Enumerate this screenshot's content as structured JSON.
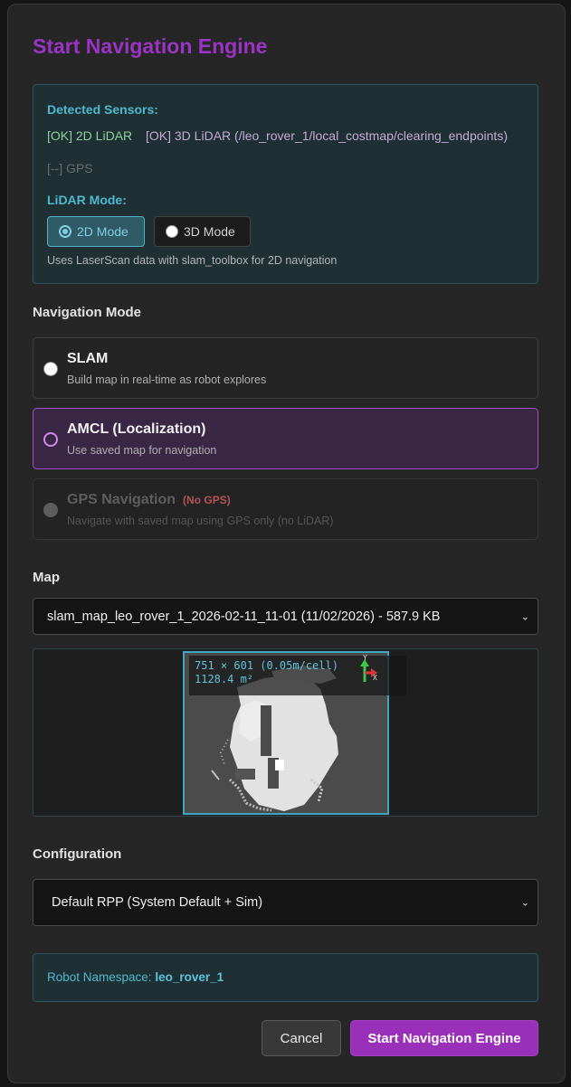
{
  "dialog": {
    "title": "Start Navigation Engine"
  },
  "sensors": {
    "heading": "Detected Sensors:",
    "lidar_2d": "[OK] 2D LiDAR",
    "lidar_3d": "[OK] 3D LiDAR (/leo_rover_1/local_costmap/clearing_endpoints)",
    "gps": "[--] GPS",
    "lidar_mode_heading": "LiDAR Mode:",
    "modes": [
      {
        "label": "2D Mode",
        "selected": true
      },
      {
        "label": "3D Mode",
        "selected": false
      }
    ],
    "mode_description": "Uses LaserScan data with slam_toolbox for 2D navigation"
  },
  "navigation": {
    "heading": "Navigation Mode",
    "options": [
      {
        "title": "SLAM",
        "description": "Build map in real-time as robot explores",
        "state": "normal"
      },
      {
        "title": "AMCL (Localization)",
        "description": "Use saved map for navigation",
        "state": "selected"
      },
      {
        "title": "GPS Navigation",
        "badge": "(No GPS)",
        "description": "Navigate with saved map using GPS only (no LiDAR)",
        "state": "disabled"
      }
    ]
  },
  "map": {
    "heading": "Map",
    "selected": "slam_map_leo_rover_1_2026-02-11_11-01 (11/02/2026) - 587.9 KB",
    "preview": {
      "dimensions": "751 × 601 (0.05m/cell)",
      "area": "1128.4 m²",
      "axis_y": "Y",
      "axis_x": "X"
    }
  },
  "configuration": {
    "heading": "Configuration",
    "selected": "Default RPP (System Default + Sim)"
  },
  "namespace": {
    "label": "Robot Namespace:",
    "value": "leo_rover_1"
  },
  "buttons": {
    "cancel": "Cancel",
    "start": "Start Navigation Engine"
  },
  "colors": {
    "title": "#9b33c4",
    "accent_cyan": "#4fb8cf",
    "ok_green": "#8fd19a",
    "selected_border": "#a24fc8",
    "no_gps_red": "#b55454",
    "primary_button": "#9a2fb9"
  }
}
